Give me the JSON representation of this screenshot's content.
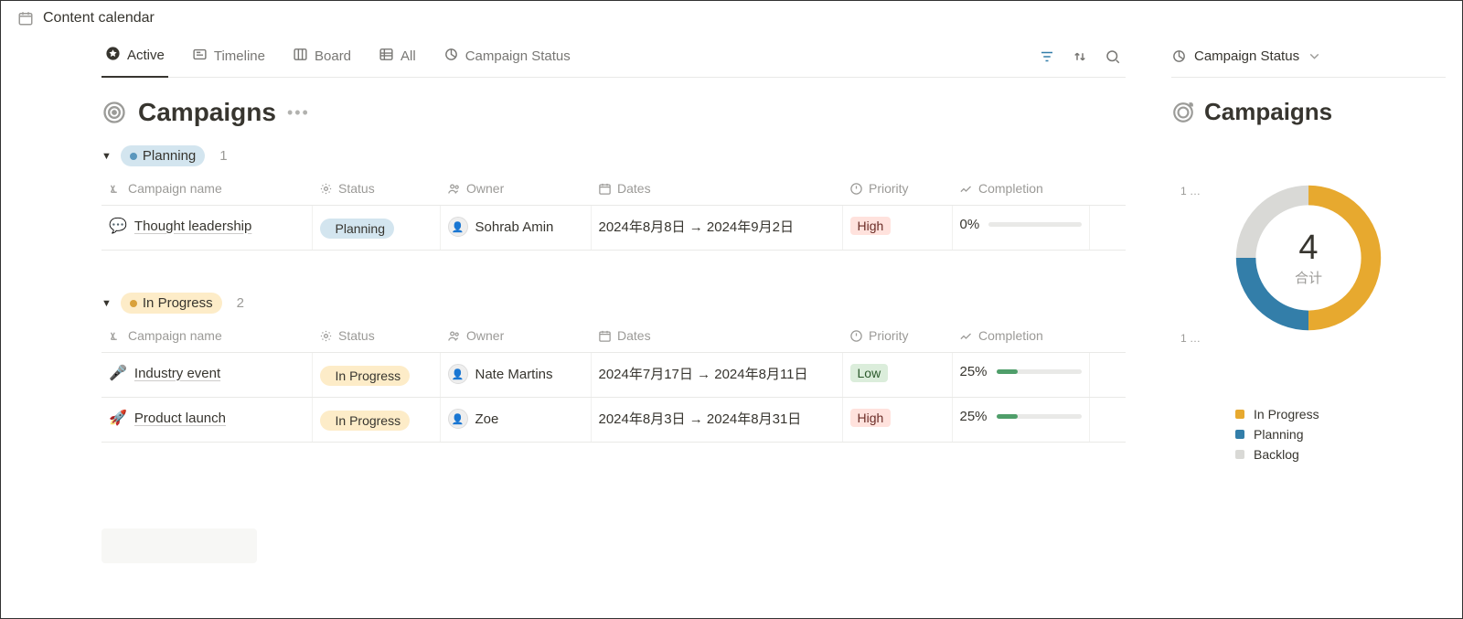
{
  "page_title": "Content calendar",
  "tabs": [
    {
      "label": "Active",
      "icon": "star-icon",
      "active": true
    },
    {
      "label": "Timeline",
      "icon": "timeline-icon"
    },
    {
      "label": "Board",
      "icon": "board-icon"
    },
    {
      "label": "All",
      "icon": "table-icon"
    },
    {
      "label": "Campaign Status",
      "icon": "donut-icon"
    }
  ],
  "main_title": "Campaigns",
  "columns": [
    "Campaign name",
    "Status",
    "Owner",
    "Dates",
    "Priority",
    "Completion"
  ],
  "groups": [
    {
      "name": "Planning",
      "color": "blue",
      "count": "1",
      "rows": [
        {
          "emoji": "💬",
          "name": "Thought leadership",
          "status": "Planning",
          "status_color": "blue",
          "owner": "Sohrab Amin",
          "dates": "2024年8月8日 → 2024年9月2日",
          "priority": "High",
          "priority_class": "prio-high",
          "completion_pct": "0%",
          "completion_val": 0
        }
      ]
    },
    {
      "name": "In Progress",
      "color": "amber",
      "count": "2",
      "rows": [
        {
          "emoji": "🎤",
          "name": "Industry event",
          "status": "In Progress",
          "status_color": "amber",
          "owner": "Nate Martins",
          "dates": "2024年7月17日 → 2024年8月11日",
          "priority": "Low",
          "priority_class": "prio-low",
          "completion_pct": "25%",
          "completion_val": 25
        },
        {
          "emoji": "🚀",
          "name": "Product launch",
          "status": "In Progress",
          "status_color": "amber",
          "owner": "Zoe",
          "dates": "2024年8月3日 → 2024年8月31日",
          "priority": "High",
          "priority_class": "prio-high",
          "completion_pct": "25%",
          "completion_val": 25
        }
      ]
    }
  ],
  "side": {
    "tab_label": "Campaign Status",
    "title": "Campaigns",
    "total": "4",
    "total_label": "合计",
    "left_label_top": "1 …",
    "left_label_bottom": "1 …",
    "legend": [
      {
        "label": "In Progress",
        "color": "#e7a92f"
      },
      {
        "label": "Planning",
        "color": "#337ea9"
      },
      {
        "label": "Backlog",
        "color": "#d9d9d6"
      }
    ]
  },
  "chart_data": {
    "type": "pie",
    "title": "Campaigns",
    "total": 4,
    "total_label": "合计",
    "series": [
      {
        "name": "In Progress",
        "value": 2,
        "color": "#e7a92f"
      },
      {
        "name": "Planning",
        "value": 1,
        "color": "#337ea9"
      },
      {
        "name": "Backlog",
        "value": 1,
        "color": "#d9d9d6"
      }
    ],
    "annotations": [
      "1 …",
      "1 …"
    ]
  }
}
